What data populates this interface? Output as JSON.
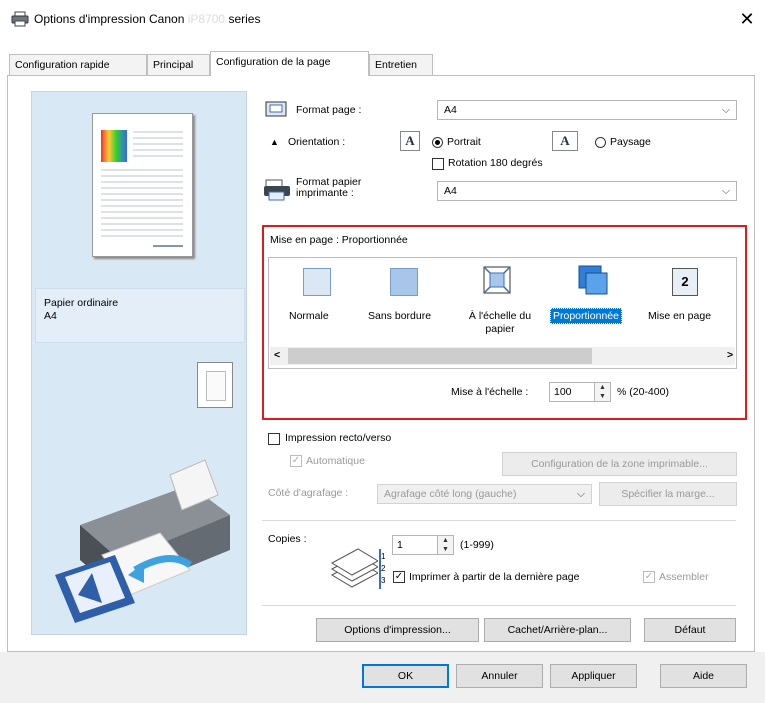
{
  "window": {
    "title_prefix": "Options d'impression Canon",
    "title_model": "iP8700",
    "title_suffix": "series",
    "close_glyph": "✕"
  },
  "tabs": [
    {
      "label": "Configuration rapide"
    },
    {
      "label": "Principal"
    },
    {
      "label": "Configuration de la page"
    },
    {
      "label": "Entretien"
    }
  ],
  "preview": {
    "paper_type": "Papier ordinaire",
    "paper_size": "A4"
  },
  "page_size": {
    "label": "Format page :",
    "value": "A4"
  },
  "orientation": {
    "label": "Orientation :",
    "portrait": "Portrait",
    "landscape": "Paysage",
    "selected": "Portrait",
    "rotate_label": "Rotation 180 degrés",
    "rotate_checked": false
  },
  "printer_paper": {
    "label_line1": "Format papier",
    "label_line2": "imprimante :",
    "value": "A4"
  },
  "layout": {
    "caption": "Mise en page : Proportionnée",
    "options": [
      {
        "label": "Normale"
      },
      {
        "label": "Sans bordure"
      },
      {
        "label_line1": "À l'échelle du",
        "label_line2": "papier"
      },
      {
        "label": "Proportionnée"
      },
      {
        "label": "Mise en page"
      }
    ],
    "selected": "Proportionnée",
    "scroll_left": "<",
    "scroll_right": ">",
    "scaling_label": "Mise à l'échelle :",
    "scaling_value": "100",
    "scaling_range": "% (20-400)"
  },
  "duplex": {
    "label": "Impression recto/verso",
    "checked": false,
    "auto_label": "Automatique",
    "area_button": "Configuration de la zone imprimable...",
    "stapling_label": "Côté d'agrafage :",
    "stapling_value": "Agrafage côté long (gauche)",
    "margin_button": "Spécifier la marge..."
  },
  "copies": {
    "label": "Copies :",
    "value": "1",
    "range": "(1-999)",
    "reverse_label": "Imprimer à partir de la dernière page",
    "reverse_checked": true,
    "collate_label": "Assembler",
    "collate_checked": true
  },
  "action_buttons": {
    "print_options": "Options d'impression...",
    "stamp": "Cachet/Arrière-plan...",
    "defaults": "Défaut"
  },
  "dialog_buttons": {
    "ok": "OK",
    "cancel": "Annuler",
    "apply": "Appliquer",
    "help": "Aide"
  },
  "colors": {
    "selection": "#0078d7",
    "highlight_box": "#e01b1b",
    "preview_bg": "#d9e8f5"
  }
}
